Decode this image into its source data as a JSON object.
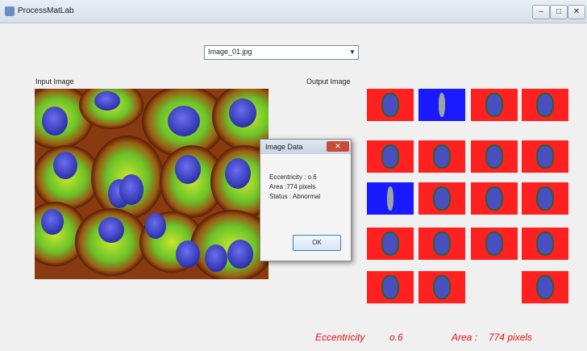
{
  "window": {
    "title": "ProcessMatLab",
    "controls": {
      "minimize": "–",
      "maximize": "□",
      "close": "✕"
    }
  },
  "image_selector": {
    "selected": "Image_01.jpg",
    "arrow": "▼"
  },
  "input_label": "Input Image",
  "output_label": "Output Image",
  "tiles": [
    {
      "row": 0,
      "col": 0,
      "bg": "#ff2020"
    },
    {
      "row": 0,
      "col": 1,
      "bg": "#1a1aff"
    },
    {
      "row": 0,
      "col": 2,
      "bg": "#ff2020"
    },
    {
      "row": 0,
      "col": 3,
      "bg": "#ff2020"
    },
    {
      "row": 1,
      "col": 0,
      "bg": "#ff2020"
    },
    {
      "row": 1,
      "col": 1,
      "bg": "#ff2020"
    },
    {
      "row": 1,
      "col": 2,
      "bg": "#ff2020"
    },
    {
      "row": 1,
      "col": 3,
      "bg": "#ff2020"
    },
    {
      "row": 2,
      "col": 0,
      "bg": "#1a1aff"
    },
    {
      "row": 2,
      "col": 1,
      "bg": "#ff2020"
    },
    {
      "row": 2,
      "col": 2,
      "bg": "#ff2020"
    },
    {
      "row": 2,
      "col": 3,
      "bg": "#ff2020"
    },
    {
      "row": 3,
      "col": 0,
      "bg": "#ff2020"
    },
    {
      "row": 3,
      "col": 1,
      "bg": "#ff2020"
    },
    {
      "row": 3,
      "col": 2,
      "bg": "#ff2020"
    },
    {
      "row": 3,
      "col": 3,
      "bg": "#ff2020"
    },
    {
      "row": 4,
      "col": 0,
      "bg": "#ff2020"
    },
    {
      "row": 4,
      "col": 1,
      "bg": "#ff2020"
    },
    {
      "row": 4,
      "col": 3,
      "bg": "#ff2020"
    }
  ],
  "dialog": {
    "title": "Image Data",
    "close": "✕",
    "lines": [
      "Eccentricity : o.6",
      "Area :774 pixels",
      "Status : Abnormal"
    ],
    "ok_label": "OK"
  },
  "results": {
    "eccentricity_label": "Eccentricity",
    "eccentricity_value": "o.6",
    "area_label": "Area :",
    "area_value": "774 pixels"
  },
  "colors": {
    "result_text": "#e01010",
    "mask_red": "#ff2020",
    "mask_blue": "#1a1aff"
  }
}
